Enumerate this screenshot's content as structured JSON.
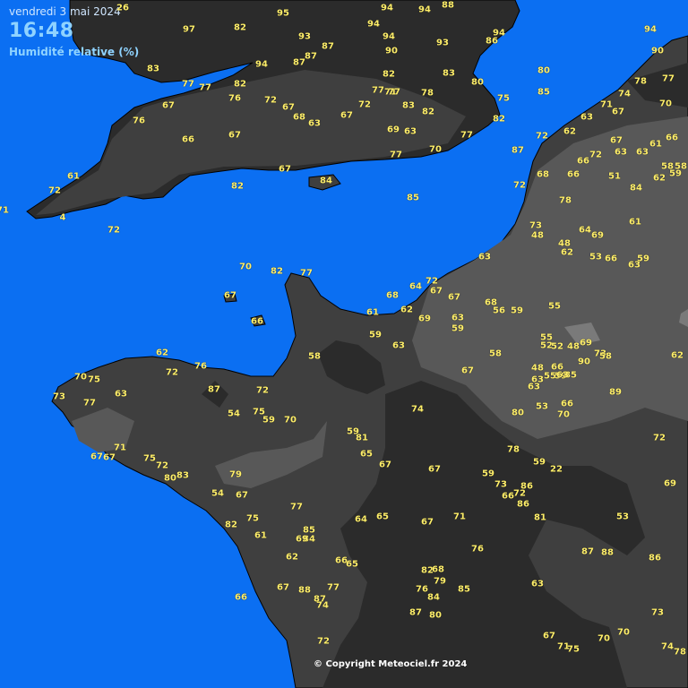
{
  "header": {
    "date": "vendredi 3 mai 2024",
    "time": "16:48",
    "parameter": "Humidité relative (%)"
  },
  "copyright": "© Copyright Meteociel.fr 2024",
  "colors": {
    "sea": "#0b6ff2",
    "land_dark": "#2b2b2b",
    "land_mid": "#3f3f3f",
    "land_light": "#585858",
    "value_text": "#ffef6a"
  },
  "values": [
    "26",
    "95",
    "94",
    "94",
    "88",
    "97",
    "82",
    "93",
    "94",
    "94",
    "87",
    "94",
    "90",
    "87",
    "94",
    "93",
    "86",
    "90",
    "83",
    "94",
    "87",
    "77",
    "82",
    "82",
    "83",
    "80",
    "80",
    "74",
    "78",
    "77",
    "77",
    "71",
    "76",
    "72",
    "77",
    "77",
    "78",
    "85",
    "75",
    "67",
    "71",
    "70",
    "67",
    "68",
    "83",
    "82",
    "82",
    "76",
    "66",
    "67",
    "63",
    "67",
    "72",
    "69",
    "63",
    "70",
    "77",
    "87",
    "72",
    "62",
    "67",
    "61",
    "66",
    "63",
    "66",
    "63",
    "63",
    "67",
    "77",
    "84",
    "68",
    "66",
    "72",
    "51",
    "62",
    "59",
    "85",
    "58",
    "58",
    "67",
    "72",
    "82",
    "72",
    "84",
    "61",
    "71",
    "4",
    "72",
    "78",
    "73",
    "61",
    "48",
    "64",
    "69",
    "48",
    "62",
    "53",
    "66",
    "63",
    "59",
    "63",
    "70",
    "82",
    "77",
    "67",
    "66",
    "68",
    "64",
    "72",
    "67",
    "67",
    "62",
    "68",
    "56",
    "59",
    "63",
    "59",
    "55",
    "61",
    "69",
    "59",
    "55",
    "52",
    "52",
    "48",
    "69",
    "73",
    "63",
    "58",
    "90",
    "85",
    "58",
    "48",
    "55",
    "59",
    "66",
    "63",
    "63",
    "63",
    "62",
    "72",
    "76",
    "70",
    "67",
    "58",
    "62",
    "89",
    "87",
    "72",
    "73",
    "77",
    "75",
    "63",
    "54",
    "75",
    "74",
    "80",
    "66",
    "53",
    "70",
    "59",
    "70",
    "59",
    "81",
    "65",
    "67",
    "78",
    "59",
    "22",
    "72",
    "69",
    "71",
    "67",
    "75",
    "72",
    "83",
    "80",
    "79",
    "67",
    "59",
    "73",
    "86",
    "66",
    "86",
    "72",
    "81",
    "67",
    "54",
    "67",
    "77",
    "85",
    "64",
    "65",
    "67",
    "71",
    "53",
    "82",
    "75",
    "61",
    "84",
    "69",
    "76",
    "87",
    "88",
    "86",
    "62",
    "66",
    "65",
    "82",
    "68",
    "79",
    "85",
    "63",
    "66",
    "67",
    "88",
    "77",
    "76",
    "84",
    "87",
    "74",
    "87",
    "80",
    "73",
    "72",
    "67",
    "71",
    "75",
    "70",
    "70",
    "74",
    "78"
  ],
  "legend_note": ""
}
